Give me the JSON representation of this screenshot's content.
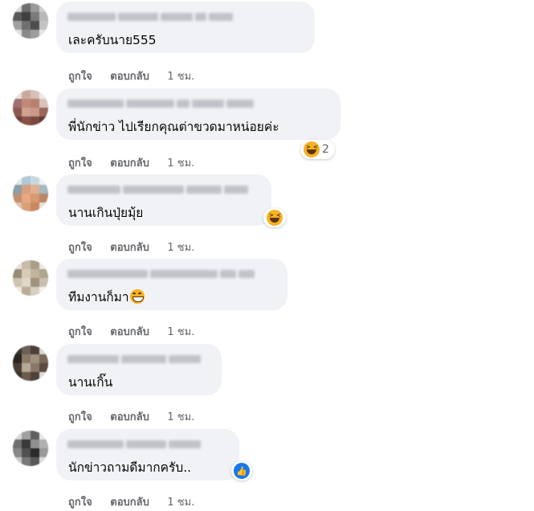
{
  "actions": {
    "like": "ถูกใจ",
    "reply": "ตอบกลับ"
  },
  "comments": [
    {
      "text": "เละครับนาย555",
      "time": "1 ชม.",
      "reaction": null
    },
    {
      "text": "พี่นักข่าว ไปเรียกคุณต่าขวดมาหน่อยค่ะ",
      "time": "1 ชม.",
      "reaction": {
        "icon": "laughing-face-icon",
        "count": "2"
      }
    },
    {
      "text": "นานเกินปุ่ยมุ้ย",
      "time": "1 ชม.",
      "reaction": {
        "icon": "laughing-face-icon",
        "count": ""
      }
    },
    {
      "text": "ทีมงานก็มา",
      "time": "1 ชม.",
      "reaction": null,
      "inline_emoji": "grinning-face-icon"
    },
    {
      "text": "นานเกิ๊น",
      "time": "1 ชม.",
      "reaction": null
    },
    {
      "text": "นักข่าวถามดีมากครับ..",
      "time": "1 ชม.",
      "reaction": {
        "icon": "thumbs-up-icon",
        "count": ""
      }
    }
  ],
  "colors": {
    "bubble": "#f0f2f5",
    "meta_text": "#65676b",
    "like_blue": "#1877f2",
    "haha_yellow": "#f7b125"
  }
}
